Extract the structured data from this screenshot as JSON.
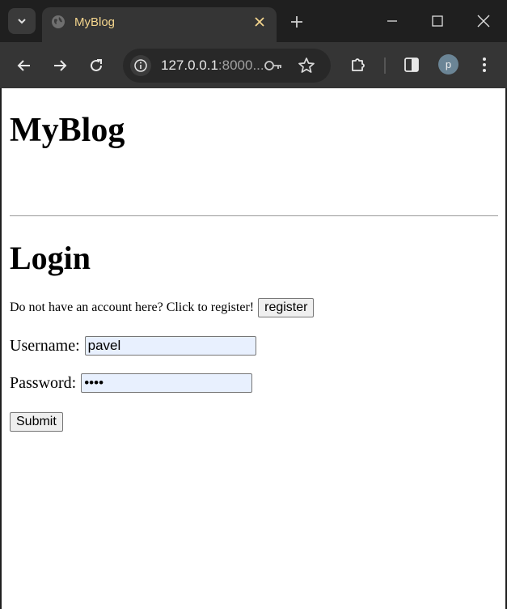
{
  "browser": {
    "tab": {
      "title": "MyBlog"
    },
    "address_bar": {
      "host": "127.0.0.1",
      "rest": ":8000..."
    },
    "profile_initial": "p",
    "colors": {
      "tab_title": "#f4d58d",
      "avatar": "#6b8596"
    }
  },
  "page": {
    "site_title": "MyBlog",
    "login_heading": "Login",
    "register_prompt": "Do not have an account here? Click to register!",
    "register_button": "register",
    "username_label": "Username:",
    "username_value": "pavel",
    "password_label": "Password:",
    "password_value": "pass",
    "submit_button": "Submit"
  }
}
